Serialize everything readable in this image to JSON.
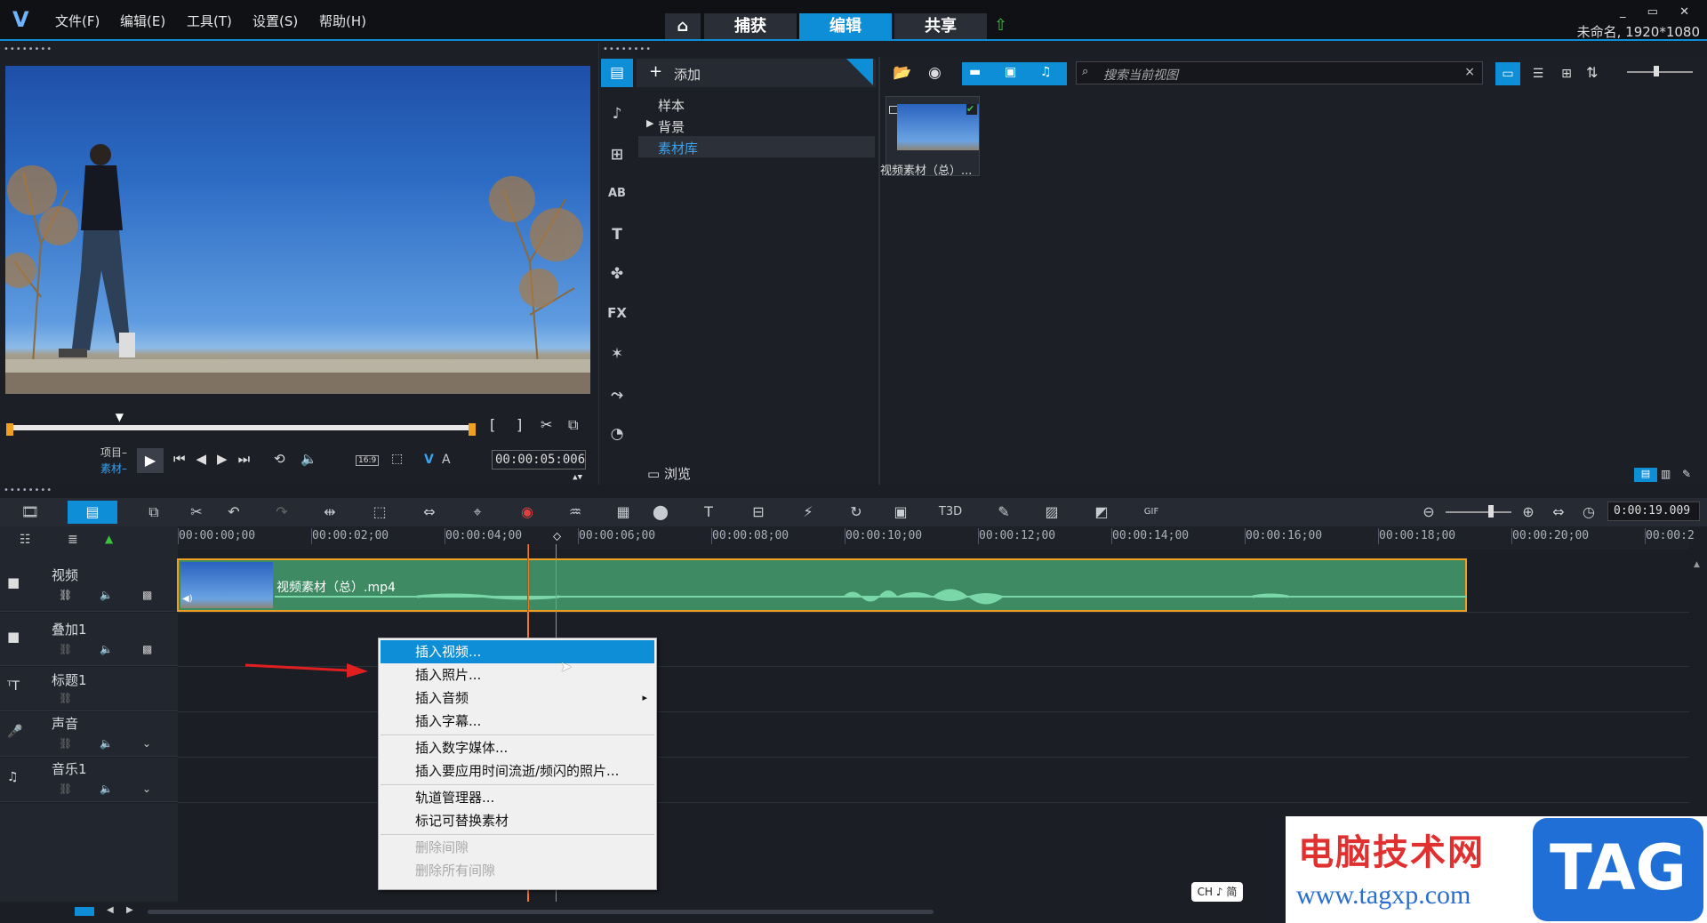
{
  "app": {
    "logo": "V",
    "project": "未命名, 1920*1080",
    "window_controls": "_ ▭ ✕"
  },
  "menu": [
    "文件(F)",
    "编辑(E)",
    "工具(T)",
    "设置(S)",
    "帮助(H)"
  ],
  "tabs": {
    "home_icon": "home-icon",
    "items": [
      "捕获",
      "编辑",
      "共享"
    ],
    "active": "编辑",
    "upload_icon": "upload-icon"
  },
  "player": {
    "mode_project": "项目",
    "mode_clip": "素材",
    "timecode": "00:00:05:006",
    "aspect": "16:9",
    "v": "V",
    "a": "A",
    "scrub_position": 0.24,
    "in_bracket": "[",
    "out_bracket": "]"
  },
  "library": {
    "add_label": "添加",
    "tree": [
      "样本",
      "背景",
      "素材库"
    ],
    "tree_selected": "素材库",
    "browse_label": "浏览",
    "search_placeholder": "搜索当前视图",
    "search_clear": "×",
    "thumb_caption": "视频素材（总）..."
  },
  "side_tools": [
    "media-icon",
    "instant-project-icon",
    "transition-icon",
    "title-ab-icon",
    "text-t-icon",
    "graphic-icon",
    "fx-icon",
    "magic-icon",
    "path-icon",
    "speed-icon"
  ],
  "side_labels": {
    "ab": "AB",
    "t": "T",
    "fx": "FX"
  },
  "timeline": {
    "timecode": "0:00:19.009",
    "ruler": [
      "00:00:00;00",
      "00:00:02;00",
      "00:00:04;00",
      "00:00:06;00",
      "00:00:08;00",
      "00:00:10;00",
      "00:00:12;00",
      "00:00:14;00",
      "00:00:16;00",
      "00:00:18;00",
      "00:00:20;00",
      "00:00:2"
    ],
    "tracks": [
      {
        "name": "视频"
      },
      {
        "name": "叠加1"
      },
      {
        "name": "标题1"
      },
      {
        "name": "声音"
      },
      {
        "name": "音乐1"
      }
    ],
    "clip_name": "视频素材（总）.mp4",
    "t3d": "T3D",
    "gif": "GIF"
  },
  "context_menu": {
    "items": [
      {
        "label": "插入视频...",
        "state": "highlighted"
      },
      {
        "label": "插入照片...",
        "state": "normal"
      },
      {
        "label": "插入音频",
        "state": "normal",
        "submenu": "▸"
      },
      {
        "label": "插入字幕...",
        "state": "normal"
      },
      {
        "label": "插入数字媒体...",
        "state": "normal"
      },
      {
        "label": "插入要应用时间流逝/频闪的照片...",
        "state": "normal"
      },
      {
        "label": "轨道管理器...",
        "state": "normal"
      },
      {
        "label": "标记可替换素材",
        "state": "normal"
      },
      {
        "label": "删除间隙",
        "state": "disabled"
      },
      {
        "label": "删除所有间隙",
        "state": "disabled"
      }
    ]
  },
  "ime": "CH ♪ 简",
  "watermark": {
    "title": "电脑技术网",
    "url": "www.tagxp.com",
    "badge": "TAG"
  },
  "colors": {
    "accent": "#0e8ed6",
    "clip": "#3d8a63",
    "wave": "#7ad8a8",
    "clip_border": "#f0a020"
  }
}
